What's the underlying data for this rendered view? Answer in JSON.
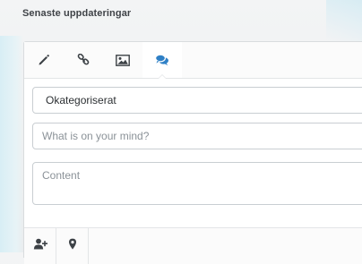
{
  "section": {
    "title": "Senaste uppdateringar"
  },
  "tabs": [
    {
      "name": "pencil-icon",
      "active": false
    },
    {
      "name": "link-icon",
      "active": false
    },
    {
      "name": "image-icon",
      "active": false
    },
    {
      "name": "chat-icon",
      "active": true
    }
  ],
  "form": {
    "category_value": "Okategoriserat",
    "title_placeholder": "What is on your mind?",
    "content_placeholder": "Content"
  },
  "footer": {
    "buttons": [
      "add-user-icon",
      "location-pin-icon"
    ]
  },
  "colors": {
    "title_text": "#3f4347",
    "icon_gray": "#3c4146",
    "active_tab_icon": "#2f80c6",
    "field_border": "#c9ced2",
    "placeholder": "#8b9298"
  }
}
